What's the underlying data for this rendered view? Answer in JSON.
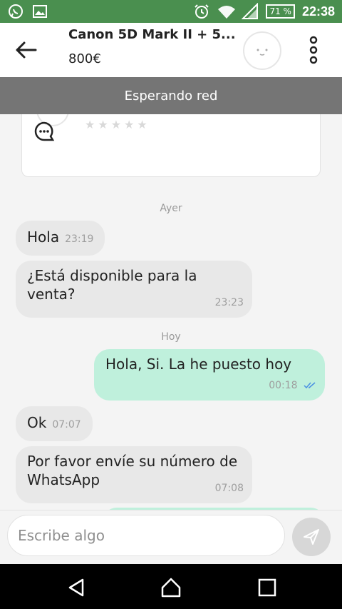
{
  "status_bar": {
    "battery": "71 %",
    "time": "22:38",
    "icons": [
      "whatsapp-icon",
      "image-icon",
      "alarm-icon",
      "wifi-icon",
      "signal-icon",
      "battery-icon"
    ]
  },
  "header": {
    "title": "Canon 5D Mark II + 5...",
    "price": "800€",
    "icons": [
      "back-arrow-icon",
      "avatar-face-icon",
      "more-vert-icon"
    ]
  },
  "banner": {
    "text": "Esperando red"
  },
  "card": {
    "icons": [
      "star-icon",
      "chat-bubble-icon"
    ]
  },
  "messages": {
    "day_yesterday": "Ayer",
    "day_today": "Hoy",
    "m1": {
      "text": "Hola",
      "time": "23:19"
    },
    "m2": {
      "text": "¿Está disponible para la venta?",
      "time": "23:23"
    },
    "m3": {
      "text": "Hola, Si. La he puesto hoy",
      "time": "00:18"
    },
    "m4": {
      "text": "Ok",
      "time": "07:07"
    },
    "m5": {
      "text": "Por favor envíe su número de WhatsApp",
      "time": "07:08"
    }
  },
  "composer": {
    "placeholder": "Escribe algo",
    "icons": [
      "send-icon"
    ]
  },
  "nav_bar": {
    "icons": [
      "nav-back-icon",
      "nav-home-icon",
      "nav-recents-icon"
    ]
  },
  "colors": {
    "status_bar": "#4a8f4f",
    "banner": "#757575",
    "incoming_bubble": "#e8e8e8",
    "outgoing_bubble": "#bff0dc",
    "read_ticks": "#4a90e2"
  }
}
